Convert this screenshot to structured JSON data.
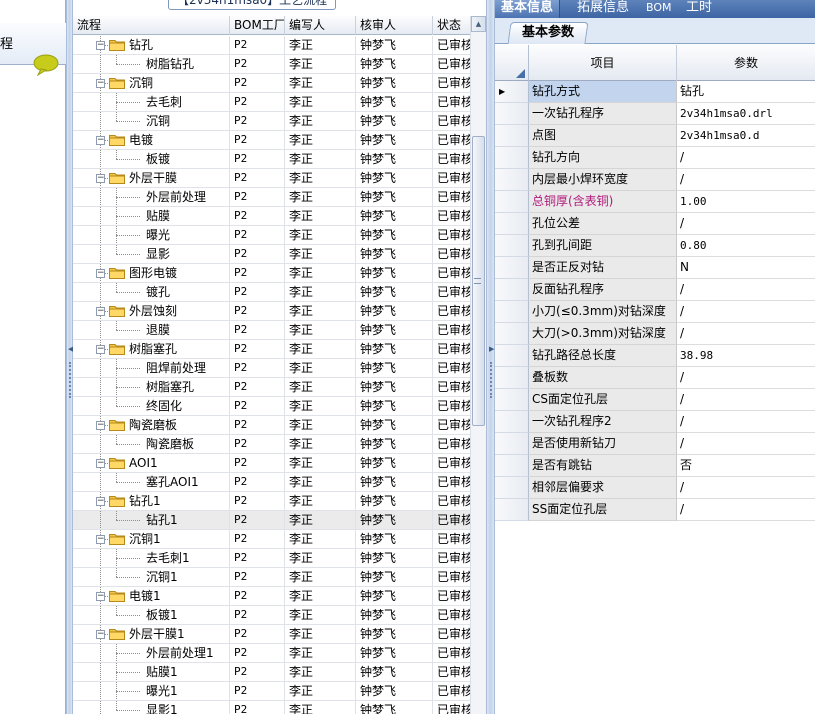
{
  "colors": {
    "accent": "#3d65a3",
    "folder": "#f2c44a",
    "highlight_label": "#b0197a",
    "chat_icon": "#c7cc1c"
  },
  "left_panel": {
    "header_text": "程"
  },
  "mid": {
    "title_tab": "【2v34h1msa0】工艺流程",
    "columns": [
      "流程",
      "BOM工厂",
      "编写人",
      "核审人",
      "状态"
    ],
    "rows": [
      {
        "level": 0,
        "label": "钻孔",
        "bom": "P2",
        "writer": "李正",
        "reviewer": "钟梦飞",
        "status": "已审核"
      },
      {
        "level": 1,
        "label": "树脂钻孔",
        "bom": "P2",
        "writer": "李正",
        "reviewer": "钟梦飞",
        "status": "已审核"
      },
      {
        "level": 0,
        "label": "沉铜",
        "bom": "P2",
        "writer": "李正",
        "reviewer": "钟梦飞",
        "status": "已审核"
      },
      {
        "level": 1,
        "label": "去毛刺",
        "bom": "P2",
        "writer": "李正",
        "reviewer": "钟梦飞",
        "status": "已审核"
      },
      {
        "level": 1,
        "label": "沉铜",
        "bom": "P2",
        "writer": "李正",
        "reviewer": "钟梦飞",
        "status": "已审核"
      },
      {
        "level": 0,
        "label": "电镀",
        "bom": "P2",
        "writer": "李正",
        "reviewer": "钟梦飞",
        "status": "已审核"
      },
      {
        "level": 1,
        "label": "板镀",
        "bom": "P2",
        "writer": "李正",
        "reviewer": "钟梦飞",
        "status": "已审核"
      },
      {
        "level": 0,
        "label": "外层干膜",
        "bom": "P2",
        "writer": "李正",
        "reviewer": "钟梦飞",
        "status": "已审核"
      },
      {
        "level": 1,
        "label": "外层前处理",
        "bom": "P2",
        "writer": "李正",
        "reviewer": "钟梦飞",
        "status": "已审核"
      },
      {
        "level": 1,
        "label": "贴膜",
        "bom": "P2",
        "writer": "李正",
        "reviewer": "钟梦飞",
        "status": "已审核"
      },
      {
        "level": 1,
        "label": "曝光",
        "bom": "P2",
        "writer": "李正",
        "reviewer": "钟梦飞",
        "status": "已审核"
      },
      {
        "level": 1,
        "label": "显影",
        "bom": "P2",
        "writer": "李正",
        "reviewer": "钟梦飞",
        "status": "已审核"
      },
      {
        "level": 0,
        "label": "图形电镀",
        "bom": "P2",
        "writer": "李正",
        "reviewer": "钟梦飞",
        "status": "已审核"
      },
      {
        "level": 1,
        "label": "镀孔",
        "bom": "P2",
        "writer": "李正",
        "reviewer": "钟梦飞",
        "status": "已审核"
      },
      {
        "level": 0,
        "label": "外层蚀刻",
        "bom": "P2",
        "writer": "李正",
        "reviewer": "钟梦飞",
        "status": "已审核"
      },
      {
        "level": 1,
        "label": "退膜",
        "bom": "P2",
        "writer": "李正",
        "reviewer": "钟梦飞",
        "status": "已审核"
      },
      {
        "level": 0,
        "label": "树脂塞孔",
        "bom": "P2",
        "writer": "李正",
        "reviewer": "钟梦飞",
        "status": "已审核"
      },
      {
        "level": 1,
        "label": "阻焊前处理",
        "bom": "P2",
        "writer": "李正",
        "reviewer": "钟梦飞",
        "status": "已审核"
      },
      {
        "level": 1,
        "label": "树脂塞孔",
        "bom": "P2",
        "writer": "李正",
        "reviewer": "钟梦飞",
        "status": "已审核"
      },
      {
        "level": 1,
        "label": "终固化",
        "bom": "P2",
        "writer": "李正",
        "reviewer": "钟梦飞",
        "status": "已审核"
      },
      {
        "level": 0,
        "label": "陶瓷磨板",
        "bom": "P2",
        "writer": "李正",
        "reviewer": "钟梦飞",
        "status": "已审核"
      },
      {
        "level": 1,
        "label": "陶瓷磨板",
        "bom": "P2",
        "writer": "李正",
        "reviewer": "钟梦飞",
        "status": "已审核"
      },
      {
        "level": 0,
        "label": "AOI1",
        "bom": "P2",
        "writer": "李正",
        "reviewer": "钟梦飞",
        "status": "已审核"
      },
      {
        "level": 1,
        "label": "塞孔AOI1",
        "bom": "P2",
        "writer": "李正",
        "reviewer": "钟梦飞",
        "status": "已审核"
      },
      {
        "level": 0,
        "label": "钻孔1",
        "bom": "P2",
        "writer": "李正",
        "reviewer": "钟梦飞",
        "status": "已审核"
      },
      {
        "level": 1,
        "label": "钻孔1",
        "bom": "P2",
        "writer": "李正",
        "reviewer": "钟梦飞",
        "status": "已审核",
        "selected": true
      },
      {
        "level": 0,
        "label": "沉铜1",
        "bom": "P2",
        "writer": "李正",
        "reviewer": "钟梦飞",
        "status": "已审核"
      },
      {
        "level": 1,
        "label": "去毛刺1",
        "bom": "P2",
        "writer": "李正",
        "reviewer": "钟梦飞",
        "status": "已审核"
      },
      {
        "level": 1,
        "label": "沉铜1",
        "bom": "P2",
        "writer": "李正",
        "reviewer": "钟梦飞",
        "status": "已审核"
      },
      {
        "level": 0,
        "label": "电镀1",
        "bom": "P2",
        "writer": "李正",
        "reviewer": "钟梦飞",
        "status": "已审核"
      },
      {
        "level": 1,
        "label": "板镀1",
        "bom": "P2",
        "writer": "李正",
        "reviewer": "钟梦飞",
        "status": "已审核"
      },
      {
        "level": 0,
        "label": "外层干膜1",
        "bom": "P2",
        "writer": "李正",
        "reviewer": "钟梦飞",
        "status": "已审核"
      },
      {
        "level": 1,
        "label": "外层前处理1",
        "bom": "P2",
        "writer": "李正",
        "reviewer": "钟梦飞",
        "status": "已审核"
      },
      {
        "level": 1,
        "label": "贴膜1",
        "bom": "P2",
        "writer": "李正",
        "reviewer": "钟梦飞",
        "status": "已审核"
      },
      {
        "level": 1,
        "label": "曝光1",
        "bom": "P2",
        "writer": "李正",
        "reviewer": "钟梦飞",
        "status": "已审核"
      },
      {
        "level": 1,
        "label": "显影1",
        "bom": "P2",
        "writer": "李正",
        "reviewer": "钟梦飞",
        "status": "已审核"
      }
    ]
  },
  "right": {
    "top_tabs": [
      "基本信息",
      "拓展信息",
      "BOM",
      "工时"
    ],
    "active_top_tab": 0,
    "sub_tab": "基本参数",
    "header": {
      "item": "项目",
      "param": "参数"
    },
    "rows": [
      {
        "name": "钻孔方式",
        "value": "钻孔",
        "selected": true
      },
      {
        "name": "一次钻孔程序",
        "value": "2v34h1msa0.drl"
      },
      {
        "name": "点图",
        "value": "2v34h1msa0.d"
      },
      {
        "name": "钻孔方向",
        "value": "/"
      },
      {
        "name": "内层最小焊环宽度",
        "value": "/"
      },
      {
        "name": "总铜厚(含表铜)",
        "value": "1.00",
        "highlight": true
      },
      {
        "name": "孔位公差",
        "value": "/"
      },
      {
        "name": "孔到孔间距",
        "value": "0.80"
      },
      {
        "name": "是否正反对钻",
        "value": "N"
      },
      {
        "name": "反面钻孔程序",
        "value": "/"
      },
      {
        "name": "小刀(≤0.3mm)对钻深度",
        "value": "/"
      },
      {
        "name": "大刀(>0.3mm)对钻深度",
        "value": "/"
      },
      {
        "name": "钻孔路径总长度",
        "value": "38.98"
      },
      {
        "name": "叠板数",
        "value": "/"
      },
      {
        "name": "CS面定位孔层",
        "value": "/"
      },
      {
        "name": "一次钻孔程序2",
        "value": "/"
      },
      {
        "name": "是否使用新钻刀",
        "value": "/"
      },
      {
        "name": "是否有跳钻",
        "value": "否"
      },
      {
        "name": "相邻层偏要求",
        "value": "/"
      },
      {
        "name": "SS面定位孔层",
        "value": "/"
      }
    ]
  }
}
